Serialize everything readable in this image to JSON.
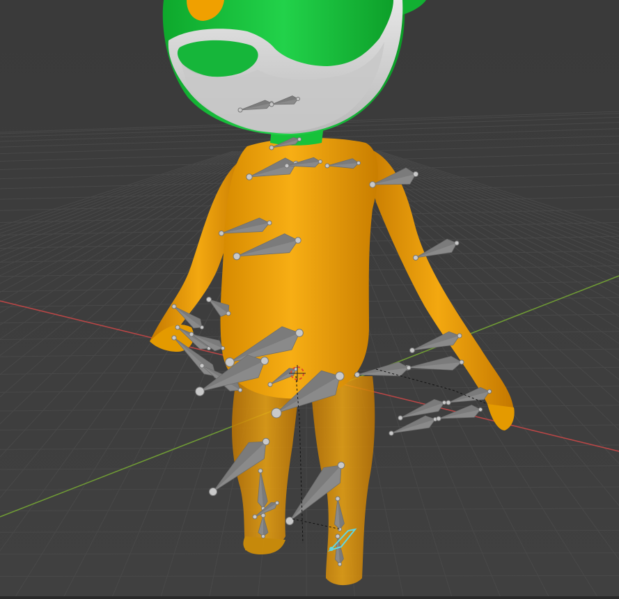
{
  "viewport": {
    "shading": "solid",
    "background_color": "#3d3d3d",
    "grid_color": "#4a4a4a",
    "x_axis_color": "#c94a4a",
    "y_axis_color": "#7aa23a"
  },
  "character": {
    "body_color": "#f0a000",
    "head_color": "#15c23c",
    "mask_color": "#d8d8d8",
    "nose_color": "#f0a000"
  },
  "armature": {
    "bone_color": "#8a8a8a",
    "joint_color": "#c9c9c9",
    "selected_bone_color": "#5fd7e6"
  },
  "cursor": {
    "icon": "3d-cursor-icon"
  }
}
